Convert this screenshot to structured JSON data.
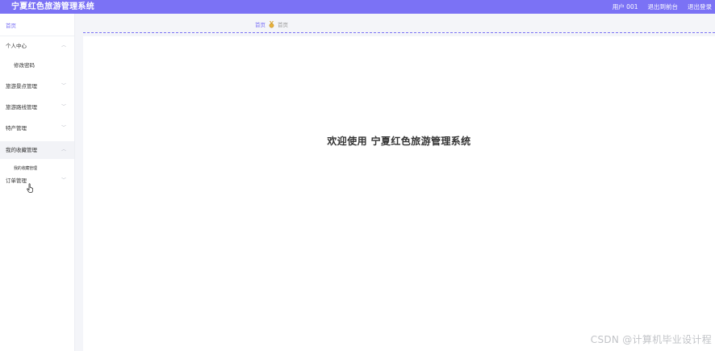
{
  "header": {
    "title": "宁夏红色旅游管理系统",
    "user": "用户 001",
    "back_to_front": "退出到前台",
    "logout": "退出登录"
  },
  "sidebar": {
    "home": "首页",
    "items": [
      {
        "label": "个人中心",
        "children": [
          "修改密码"
        ]
      },
      {
        "label": "旅游景点管理"
      },
      {
        "label": "旅游路线管理"
      },
      {
        "label": "特产管理"
      },
      {
        "label": "我的收藏管理",
        "children": [
          "我的收藏管理"
        ]
      },
      {
        "label": "订单管理"
      }
    ]
  },
  "breadcrumb": {
    "home": "首页",
    "current": "首页"
  },
  "main": {
    "welcome": "欢迎使用 宁夏红色旅游管理系统"
  },
  "watermark": "CSDN @计算机毕业设计程",
  "colors": {
    "accent": "#7b72f5",
    "background": "#f4f5f9"
  }
}
